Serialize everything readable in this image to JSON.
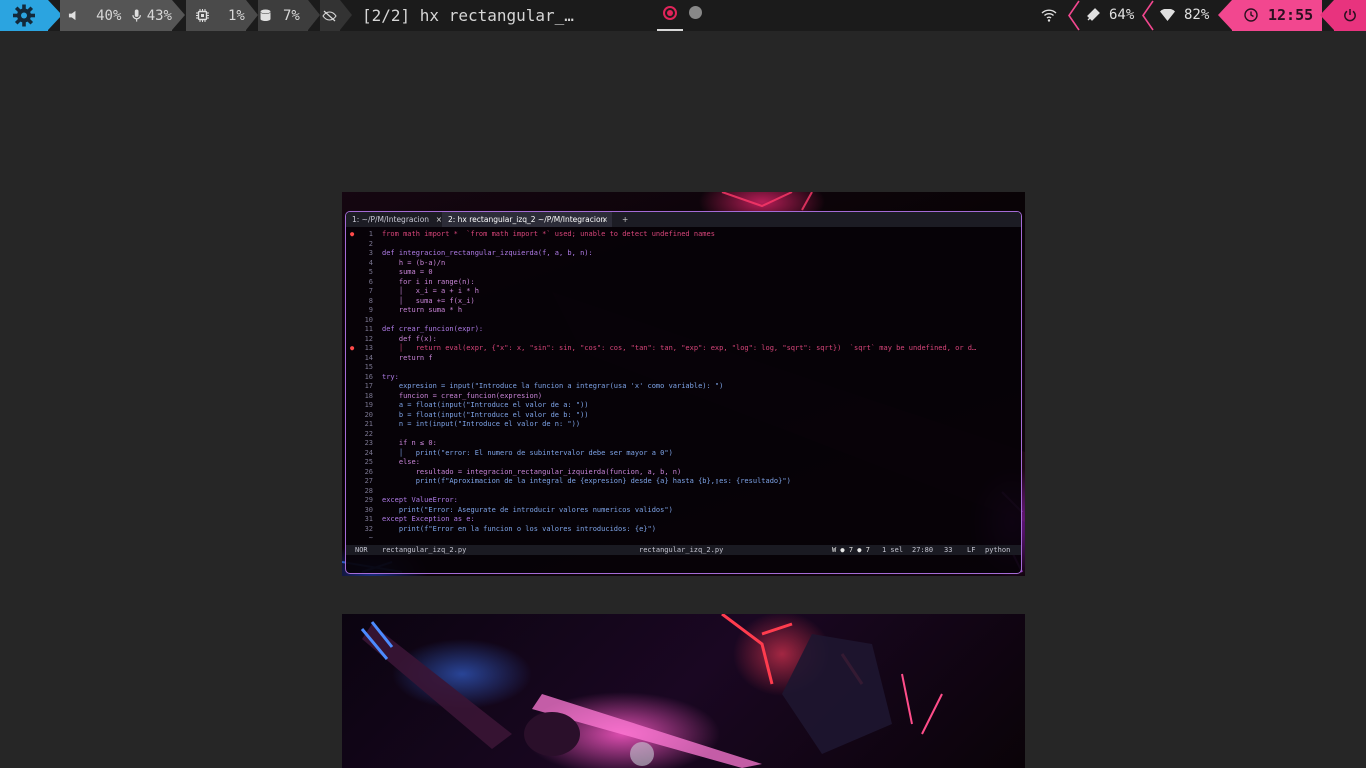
{
  "colors": {
    "launcher": "#2ba4e0",
    "clock_bg": "#f2478f",
    "power_bg": "#e8337e",
    "active_workspace": "#e0245a",
    "terminal_border": "#a46bd6",
    "error_dot": "#ff4a4a"
  },
  "topbar": {
    "launcher_icon": "gear-icon",
    "volume": "40%",
    "mic": "43%",
    "cpu": "1%",
    "memory": "7%",
    "window_title": "[2/2] hx rectangular_…",
    "wifi_icon": "wifi-icon",
    "battery": "64%",
    "wifi_strength": "82%",
    "clock": "12:55",
    "power_icon": "power-icon"
  },
  "terminal": {
    "tabs": [
      {
        "label": "1: ~/P/M/Integracion",
        "close": "×"
      },
      {
        "label": "2: hx rectangular_izq_2 ~/P/M/Integracion",
        "close": "×"
      }
    ],
    "new_tab": "+",
    "lines": [
      {
        "n": "1",
        "err": "●",
        "text": "from math import *  `from math import *` used; unable to detect undefined names"
      },
      {
        "n": "2",
        "err": "",
        "text": ""
      },
      {
        "n": "3",
        "err": "",
        "text": "def integracion_rectangular_izquierda(f, a, b, n):"
      },
      {
        "n": "4",
        "err": "",
        "text": "    h = (b-a)/n"
      },
      {
        "n": "5",
        "err": "",
        "text": "    suma = 0"
      },
      {
        "n": "6",
        "err": "",
        "text": "    for i in range(n):"
      },
      {
        "n": "7",
        "err": "",
        "text": "    │   x_i = a + i * h"
      },
      {
        "n": "8",
        "err": "",
        "text": "    │   suma += f(x_i)"
      },
      {
        "n": "9",
        "err": "",
        "text": "    return suma * h"
      },
      {
        "n": "10",
        "err": "",
        "text": ""
      },
      {
        "n": "11",
        "err": "",
        "text": "def crear_funcion(expr):"
      },
      {
        "n": "12",
        "err": "",
        "text": "    def f(x):"
      },
      {
        "n": "13",
        "err": "●",
        "text": "    │   return eval(expr, {\"x\": x, \"sin\": sin, \"cos\": cos, \"tan\": tan, \"exp\": exp, \"log\": log, \"sqrt\": sqrt})  `sqrt` may be undefined, or d…"
      },
      {
        "n": "14",
        "err": "",
        "text": "    return f"
      },
      {
        "n": "15",
        "err": "",
        "text": ""
      },
      {
        "n": "16",
        "err": "",
        "text": "try:"
      },
      {
        "n": "17",
        "err": "",
        "text": "    expresion = input(\"Introduce la funcion a integrar(usa 'x' como variable): \")"
      },
      {
        "n": "18",
        "err": "",
        "text": "    funcion = crear_funcion(expresion)"
      },
      {
        "n": "19",
        "err": "",
        "text": "    a = float(input(\"Introduce el valor de a: \"))"
      },
      {
        "n": "20",
        "err": "",
        "text": "    b = float(input(\"Introduce el valor de b: \"))"
      },
      {
        "n": "21",
        "err": "",
        "text": "    n = int(input(\"Introduce el valor de n: \"))"
      },
      {
        "n": "22",
        "err": "",
        "text": ""
      },
      {
        "n": "23",
        "err": "",
        "text": "    if n ≤ 0:"
      },
      {
        "n": "24",
        "err": "",
        "text": "    │   print(\"error: El numero de subintervalor debe ser mayor a 0\")"
      },
      {
        "n": "25",
        "err": "",
        "text": "    else:"
      },
      {
        "n": "26",
        "err": "",
        "text": "        resultado = integracion_rectangular_izquierda(funcion, a, b, n)"
      },
      {
        "n": "27",
        "err": "",
        "text": "        print(f\"Aproximacion de la integral de {expresion} desde {a} hasta {b},▯es: {resultado}\")"
      },
      {
        "n": "28",
        "err": "",
        "text": ""
      },
      {
        "n": "29",
        "err": "",
        "text": "except ValueError:"
      },
      {
        "n": "30",
        "err": "",
        "text": "    print(\"Error: Asegurate de introducir valores numericos validos\")"
      },
      {
        "n": "31",
        "err": "",
        "text": "except Exception as e:"
      },
      {
        "n": "32",
        "err": "",
        "text": "    print(f\"Error en la funcion o los valores introducidos: {e}\")"
      },
      {
        "n": "~",
        "err": "",
        "text": ""
      }
    ],
    "status": {
      "mode": "NOR",
      "file_left": "rectangular_izq_2.py",
      "file_center": "rectangular_izq_2.py",
      "diagnostics": "W ● 7 ● 7",
      "selection": "1 sel",
      "position": "27:80",
      "count": "33",
      "line_ending": "LF",
      "language": "python"
    }
  }
}
